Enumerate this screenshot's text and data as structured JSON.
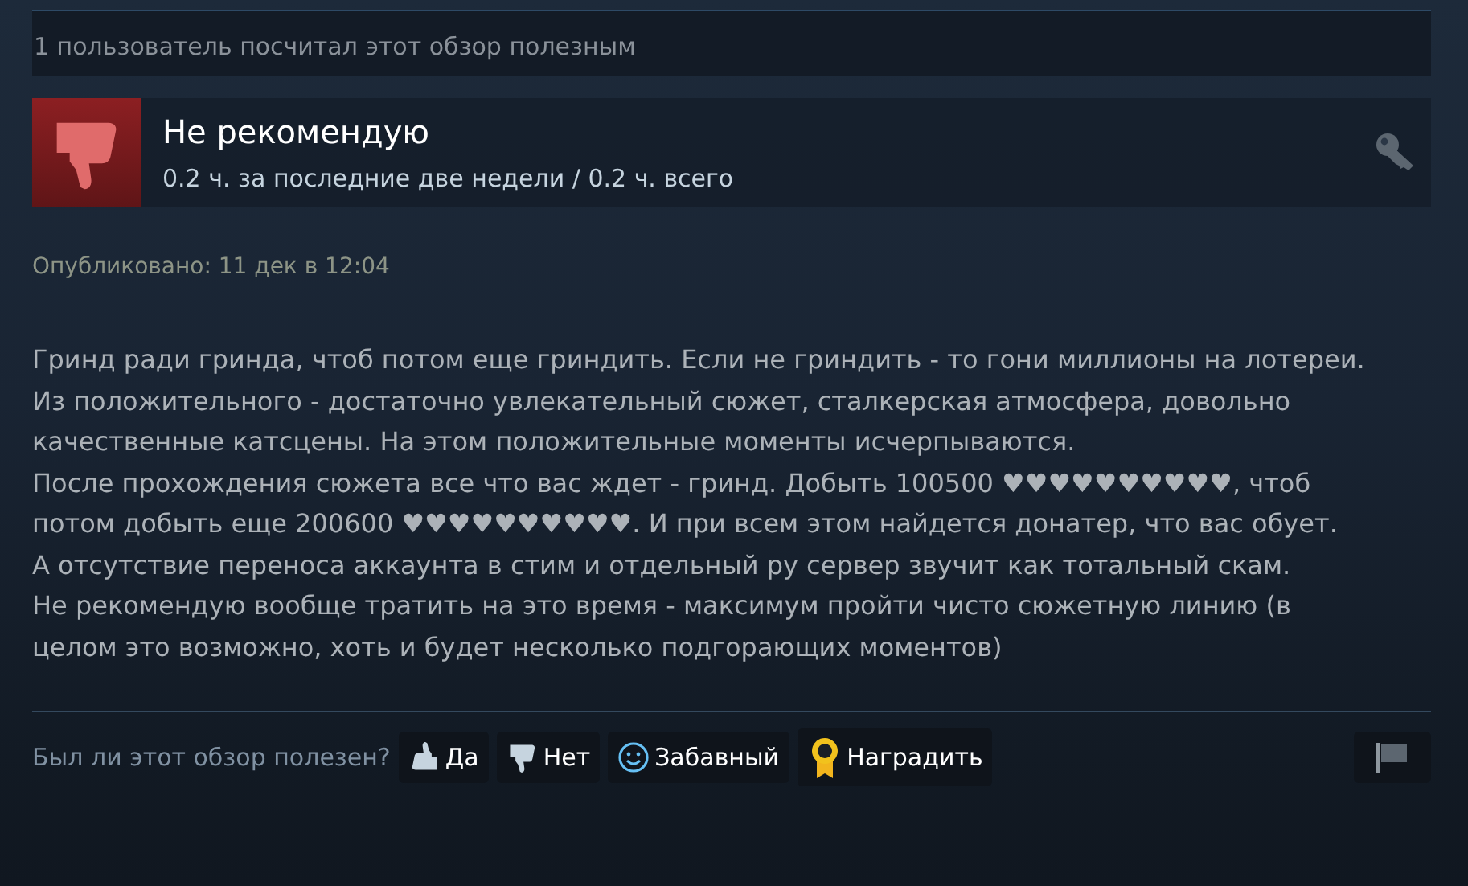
{
  "helpful_summary": "1 пользователь посчитал этот обзор полезным",
  "review": {
    "recommended": false,
    "verdict": "Не рекомендую",
    "hours": "0.2 ч. за последние две недели / 0.2 ч. всего",
    "posted": "Опубликовано: 11 дек в 12:04",
    "paragraphs": [
      "Гринд ради гринда, чтоб потом еще гриндить. Если не гриндить - то гони миллионы на лотереи.",
      "Из положительного - достаточно увлекательный сюжет, сталкерская атмосфера, довольно качественные катсцены. На этом положительные моменты исчерпываются.",
      "После прохождения сюжета все что вас ждет - гринд. Добыть 100500 ♥♥♥♥♥♥♥♥♥♥, чтоб потом добыть еще 200600 ♥♥♥♥♥♥♥♥♥♥. И при всем этом найдется донатер, что вас обует.",
      "А отсутствие переноса аккаунта в стим и отдельный ру сервер звучит как тотальный скам.",
      "Не рекомендую вообще тратить на это время - максимум пройти чисто сюжетную линию (в целом это возможно, хоть и будет несколько подгорающих моментов)"
    ]
  },
  "vote": {
    "question": "Был ли этот обзор полезен?",
    "buttons": [
      {
        "kind": "yes",
        "label": "Да"
      },
      {
        "kind": "no",
        "label": "Нет"
      },
      {
        "kind": "funny",
        "label": "Забавный"
      },
      {
        "kind": "award",
        "label": "Наградить"
      }
    ]
  }
}
